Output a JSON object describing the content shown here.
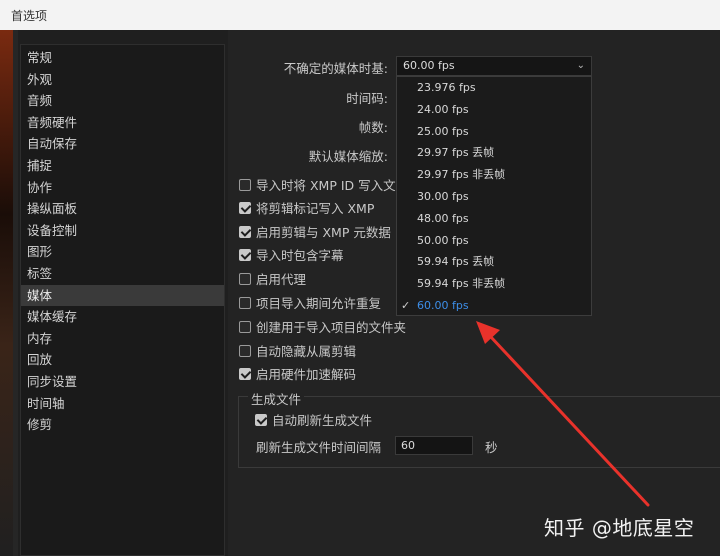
{
  "window": {
    "title": "首选项"
  },
  "sidebar": {
    "items": [
      {
        "label": "常规"
      },
      {
        "label": "外观"
      },
      {
        "label": "音频"
      },
      {
        "label": "音频硬件"
      },
      {
        "label": "自动保存"
      },
      {
        "label": "捕捉"
      },
      {
        "label": "协作"
      },
      {
        "label": "操纵面板"
      },
      {
        "label": "设备控制"
      },
      {
        "label": "图形"
      },
      {
        "label": "标签"
      },
      {
        "label": "媒体"
      },
      {
        "label": "媒体缓存"
      },
      {
        "label": "内存"
      },
      {
        "label": "回放"
      },
      {
        "label": "同步设置"
      },
      {
        "label": "时间轴"
      },
      {
        "label": "修剪"
      }
    ],
    "selected": "媒体"
  },
  "media": {
    "timebase_label": "不确定的媒体时基:",
    "timebase_value": "60.00 fps",
    "timecode_label": "时间码:",
    "frame_label": "帧数:",
    "scale_label": "默认媒体缩放:",
    "dropdown_options": [
      {
        "label": "23.976 fps"
      },
      {
        "label": "24.00 fps"
      },
      {
        "label": "25.00 fps"
      },
      {
        "label": "29.97 fps 丢帧"
      },
      {
        "label": "29.97 fps 非丢帧"
      },
      {
        "label": "30.00 fps"
      },
      {
        "label": "48.00 fps"
      },
      {
        "label": "50.00 fps"
      },
      {
        "label": "59.94 fps 丢帧"
      },
      {
        "label": "59.94 fps 非丢帧"
      },
      {
        "label": "60.00 fps"
      }
    ],
    "selected_option": "60.00 fps",
    "checkboxes": [
      {
        "label": "导入时将 XMP ID 写入文",
        "checked": false
      },
      {
        "label": "将剪辑标记写入 XMP",
        "checked": true
      },
      {
        "label": "启用剪辑与 XMP 元数据",
        "checked": true
      },
      {
        "label": "导入时包含字幕",
        "checked": true
      },
      {
        "label": "启用代理",
        "checked": false
      },
      {
        "label": "项目导入期间允许重复",
        "checked": false
      },
      {
        "label": "创建用于导入项目的文件夹",
        "checked": false
      },
      {
        "label": "自动隐藏从属剪辑",
        "checked": false
      },
      {
        "label": "启用硬件加速解码",
        "checked": true
      }
    ],
    "generated_files": {
      "title": "生成文件",
      "auto_refresh": {
        "label": "自动刷新生成文件",
        "checked": true
      },
      "interval_label": "刷新生成文件时间间隔",
      "interval_value": "60",
      "interval_unit": "秒"
    }
  },
  "annotation": {
    "arrow_color": "#e8322b"
  },
  "watermark": {
    "text": "知乎 @地底星空"
  }
}
